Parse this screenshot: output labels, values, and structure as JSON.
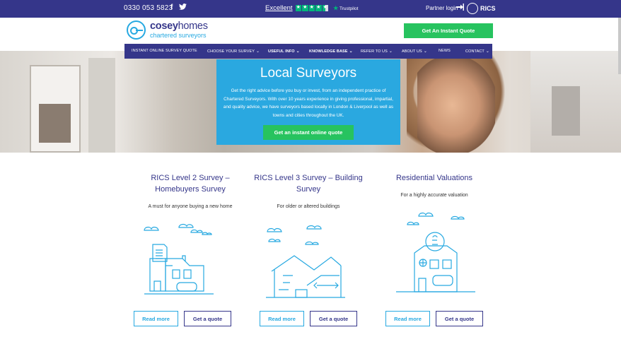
{
  "topbar": {
    "phone": "0330 053 5823",
    "facebook": "f",
    "twitter": "twitter-icon",
    "trustpilot_excellent": "Excellent",
    "trustpilot_logo": "Trustpilot",
    "partner_login": "Partner login",
    "rics": "RICS"
  },
  "header": {
    "logo_bold": "cosey",
    "logo_rest": "homes",
    "logo_sub": "chartered surveyors",
    "quote_button": "Get An Instant Quote"
  },
  "nav": {
    "items": [
      {
        "label": "INSTANT ONLINE SURVEY QUOTE",
        "chevron": ""
      },
      {
        "label": "CHOOSE YOUR SURVEY",
        "chevron": "⌄"
      },
      {
        "label": "USEFUL INFO",
        "chevron": "⌄"
      },
      {
        "label": "KNOWLEDGE BASE",
        "chevron": "⌄"
      },
      {
        "label": "REFER TO US",
        "chevron": "⌄"
      },
      {
        "label": "ABOUT US",
        "chevron": "⌄"
      },
      {
        "label": "NEWS",
        "chevron": ""
      },
      {
        "label": "CONTACT",
        "chevron": "⌄"
      }
    ]
  },
  "hero": {
    "title": "Local Surveyors",
    "text": "Get the right advice before you buy or invest, from an independent practice of Chartered Surveyors. With over 10 years experience in giving professional, impartial, and quality advice, we have surveyors based locally in London & Liverpool as well as towns and cities throughout the UK.",
    "cta": "Get an instant online quote"
  },
  "cards": [
    {
      "title": "RICS Level 2 Survey – Homebuyers Survey",
      "desc": "A must for anyone buying a new home",
      "read_more": "Read more",
      "get_quote": "Get a quote"
    },
    {
      "title": "RICS Level 3 Survey – Building Survey",
      "desc": "For older or altered buildings",
      "read_more": "Read more",
      "get_quote": "Get a quote"
    },
    {
      "title": "Residential Valuations",
      "desc": "For a highly accurate valuation",
      "read_more": "Read more",
      "get_quote": "Get a quote"
    }
  ],
  "colors": {
    "navy": "#35368a",
    "accent": "#27a9e1",
    "green": "#27c35f",
    "trustpilot": "#00b67a"
  }
}
